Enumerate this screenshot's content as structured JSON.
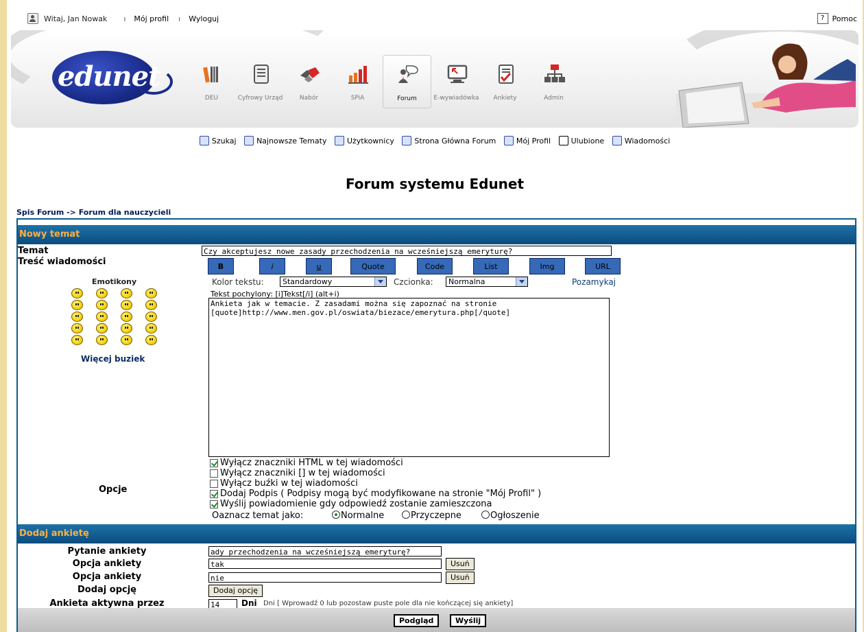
{
  "topbar": {
    "greeting": "Witaj, Jan Nowak",
    "my_profile": "Mój profil",
    "logout": "Wyloguj",
    "help": "Pomoc"
  },
  "logo_text": "edunet",
  "nav": [
    {
      "label": "DEU",
      "icon": "books-icon"
    },
    {
      "label": "Cyfrowy Urząd",
      "icon": "document-icon"
    },
    {
      "label": "Nabór",
      "icon": "handshake-icon"
    },
    {
      "label": "SPiA",
      "icon": "bar-chart-icon"
    },
    {
      "label": "Forum",
      "icon": "forum-icon",
      "active": true
    },
    {
      "label": "E-wywiadówka",
      "icon": "monitor-icon"
    },
    {
      "label": "Ankiety",
      "icon": "survey-icon"
    },
    {
      "label": "Admin",
      "icon": "network-icon"
    }
  ],
  "subnav": [
    {
      "label": "Szukaj",
      "icon": "search-icon"
    },
    {
      "label": "Najnowsze Tematy",
      "icon": "newest-icon"
    },
    {
      "label": "Użytkownicy",
      "icon": "users-icon"
    },
    {
      "label": "Strona Główna Forum",
      "icon": "home-icon"
    },
    {
      "label": "Mój Profil",
      "icon": "profile-icon"
    },
    {
      "label": "Ulubione",
      "icon": "favorites-icon"
    },
    {
      "label": "Wiadomości",
      "icon": "messages-icon"
    }
  ],
  "forum_title": "Forum systemu Edunet",
  "breadcrumb": "Spis Forum -> Forum dla nauczycieli",
  "new_topic": {
    "header": "Nowy temat",
    "subject_label": "Temat",
    "subject_value": "Czy akceptujesz nowe zasady przechodzenia na wcześniejszą emeryturę?",
    "body_label": "Treść wiadomości",
    "format_buttons": [
      "B",
      "i",
      "u",
      "Quote",
      "Code",
      "List",
      "Img",
      "URL"
    ],
    "color_label": "Kolor tekstu:",
    "color_value": "Standardowy",
    "font_label": "Czcionka:",
    "font_value": "Normalna",
    "close_tags": "Pozamykaj",
    "hint": "Tekst pochylony: [i]Tekst[/i]  (alt+i)",
    "emoticons_label": "Emotikony",
    "more_emoticons": "Więcej buziek",
    "message": "Ankieta jak w temacie. Z zasadami można się zapoznać na stronie\n[quote]http://www.men.gov.pl/oswiata/biezace/emerytura.php[/quote]",
    "options_label": "Opcje",
    "options": [
      {
        "label": "Wyłącz znaczniki HTML w tej wiadomości",
        "checked": true
      },
      {
        "label": "Wyłącz znaczniki [] w tej wiadomości",
        "checked": false
      },
      {
        "label": "Wyłącz buźki w tej wiadomości",
        "checked": false
      },
      {
        "label": "Dodaj Podpis ( Podpisy mogą być modyfikowane na stronie \"Mój Profil\" )",
        "checked": true
      },
      {
        "label": "Wyślij powiadomienie gdy odpowiedź zostanie zamieszczona",
        "checked": true
      }
    ],
    "mark_as_label": "Oaznacz temat jako:",
    "mark_as": [
      {
        "label": "Normalne",
        "selected": true
      },
      {
        "label": "Przyczepne",
        "selected": false
      },
      {
        "label": "Ogłoszenie",
        "selected": false
      }
    ]
  },
  "poll": {
    "header": "Dodaj ankietę",
    "question_label": "Pytanie ankiety",
    "question_value": "ady przechodzenia na wcześniejszą emeryturę?",
    "option_label": "Opcja ankiety",
    "options": [
      "tak",
      "nie"
    ],
    "remove_label": "Usuń",
    "add_option_label": "Dodaj opcję",
    "add_option_button": "Dodaj opcję",
    "active_label": "Ankieta aktywna przez",
    "days_value": "14",
    "days_unit": "Dni",
    "days_hint": "Dni [ Wprowadź 0 lub pozostaw puste pole dla nie kończącej się ankiety]"
  },
  "actions": {
    "preview": "Podgląd",
    "send": "Wyślij"
  }
}
